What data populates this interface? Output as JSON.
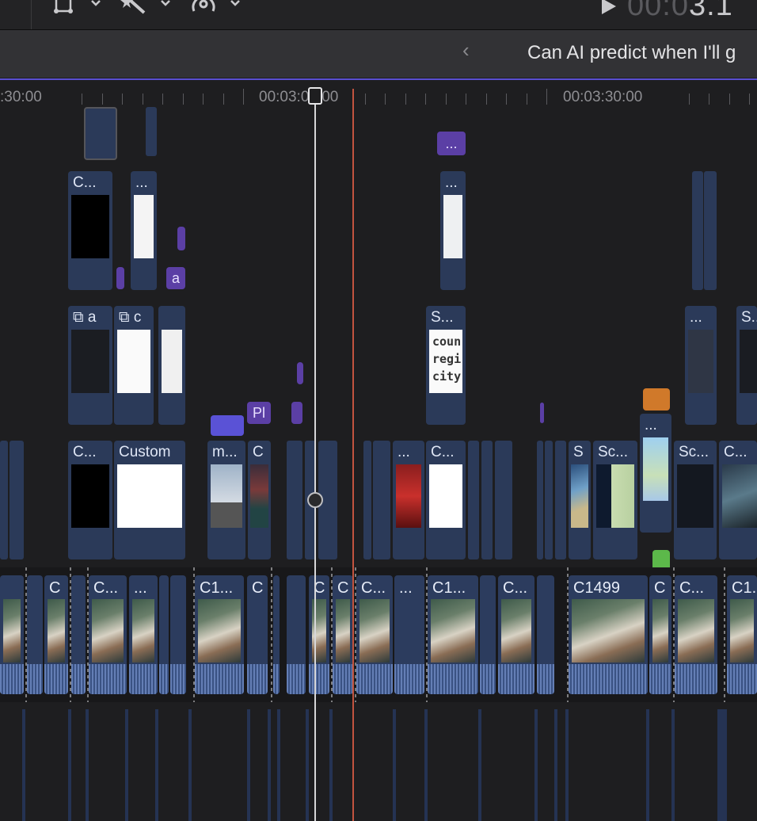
{
  "toolbar": {
    "transform_icon": "crop-transform-icon",
    "magic_icon": "magic-wand-icon",
    "speed_icon": "speedometer-icon",
    "timecode_dim": "00:0",
    "timecode_lit": "3.1",
    "play_icon": "play-icon"
  },
  "header": {
    "back_icon": "chevron-left-icon",
    "back_glyph": "‹",
    "project_title": "Can AI predict when I'll g"
  },
  "ruler": {
    "labels": [
      ":30:00",
      "00:03:00:00",
      "00:03:30:00"
    ]
  },
  "clips": {
    "c1": "C...",
    "c2": "...",
    "c3": "...",
    "a_marker": "a",
    "title_a": "a",
    "title_c": "c",
    "s_clip": "S...",
    "s_code": "coun\nregi\ncity",
    "dots_right": "...",
    "s_right": "S...",
    "pl_marker": "Pl",
    "c_black": "C...",
    "custom": "Custom",
    "m_clip": "m...",
    "c_small": "C",
    "dots_red": "...",
    "c_white": "C...",
    "s_map": "S",
    "sc_map": "Sc...",
    "dots_map": "...",
    "sc_right": "Sc...",
    "c_right": "C...",
    "purple_top": "..."
  },
  "storyline": {
    "labels": [
      "C",
      "C...",
      "...",
      "C1...",
      "C",
      "C",
      "C",
      "C...",
      "...",
      "C1...",
      "C...",
      "C1499",
      "C",
      "C...",
      "C1..."
    ]
  },
  "colors": {
    "clip": "#2b3a59",
    "marker": "#5b3fa5",
    "playhead": "#d7d7d9",
    "skimmer": "#c2543f",
    "orange_marker": "#d0792a",
    "green_marker": "#5cb84a"
  }
}
